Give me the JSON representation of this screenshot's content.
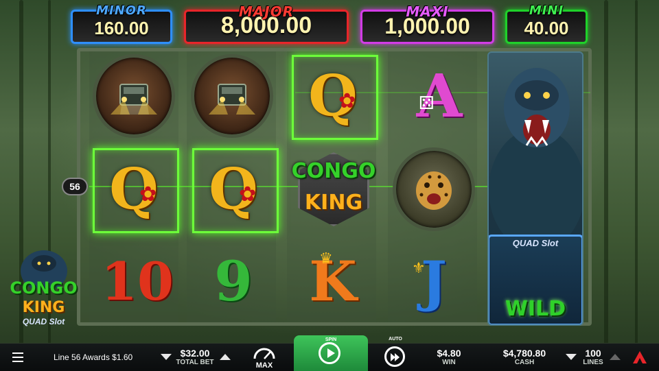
{
  "jackpots": {
    "minor": {
      "title": "MINOR",
      "value": "160.00"
    },
    "major": {
      "title": "MAJOR",
      "value": "8,000.00"
    },
    "maxi": {
      "title": "MAXI",
      "value": "1,000.00"
    },
    "mini": {
      "title": "MINI",
      "value": "40.00"
    }
  },
  "reels": {
    "row1": [
      "jeep-icon",
      "jeep-icon",
      "Q",
      "A",
      "gorilla-icon"
    ],
    "row2": [
      "Q",
      "Q",
      "CONGO KING",
      "leopard-icon",
      "gorilla-icon"
    ],
    "row3": [
      "10",
      "9",
      "K",
      "J",
      "WILD"
    ],
    "scatter_title": "CONGO",
    "scatter_subtitle": "KING",
    "wild_label": "WILD",
    "wild_badge": "QUAD Slot"
  },
  "logo": {
    "line1": "CONGO",
    "line2": "KING",
    "line3": "QUAD Slot"
  },
  "payline_badge": "56",
  "status": {
    "message": "Line 56 Awards $1.60"
  },
  "bet": {
    "value": "$32.00",
    "label": "TOTAL BET"
  },
  "max_label": "MAX",
  "spin_label": "SPIN",
  "auto_label": "AUTO",
  "win": {
    "value": "$4.80",
    "label": "WIN"
  },
  "cash": {
    "value": "$4,780.80",
    "label": "CASH"
  },
  "lines": {
    "value": "100",
    "label": "LINES"
  },
  "colors": {
    "minor": "#2e8fff",
    "major": "#e8252a",
    "maxi": "#d23ce6",
    "mini": "#1fd12a",
    "win_highlight": "#6dff3a",
    "spin": "#2ea84a"
  }
}
